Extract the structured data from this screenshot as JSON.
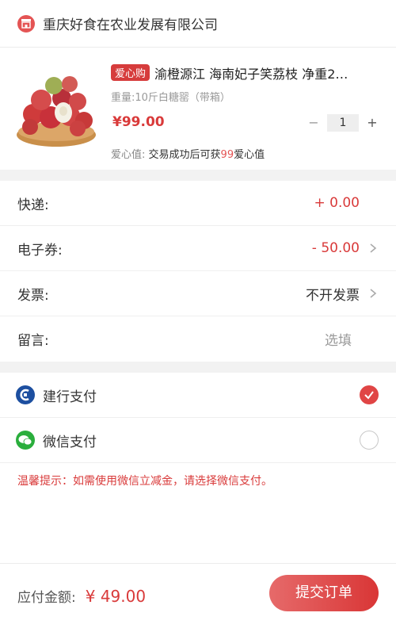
{
  "store": {
    "name": "重庆好食在农业发展有限公司",
    "icon": "shop-icon"
  },
  "product": {
    "tag": "爱心购",
    "title": "渝橙源江 海南妃子笑荔枝 净重2…",
    "spec": "重量:10斤白糖罂（带箱）",
    "price": "¥99.00",
    "quantity": "1",
    "minus": "−",
    "plus": "+",
    "love_label": "爱心值:",
    "love_text_pre": "交易成功后可获",
    "love_points": "99",
    "love_text_post": "爱心值"
  },
  "fees": {
    "express_label": "快递:",
    "express_value": "+ 0.00",
    "coupon_label": "电子券:",
    "coupon_value": "- 50.00",
    "invoice_label": "发票:",
    "invoice_value": "不开发票",
    "note_label": "留言:",
    "note_placeholder": "选填"
  },
  "payment": {
    "options": [
      {
        "label": "建行支付",
        "icon": "ccb-icon",
        "selected": true
      },
      {
        "label": "微信支付",
        "icon": "wechat-icon",
        "selected": false
      }
    ],
    "tip": "温馨提示：如需使用微信立减金，请选择微信支付。"
  },
  "footer": {
    "total_label": "应付金额:",
    "total_value": "¥ 49.00",
    "submit_label": "提交订单"
  },
  "colors": {
    "accent": "#d93a3a",
    "ccb_blue": "#1d4fa0",
    "wechat_green": "#2aae3c"
  }
}
